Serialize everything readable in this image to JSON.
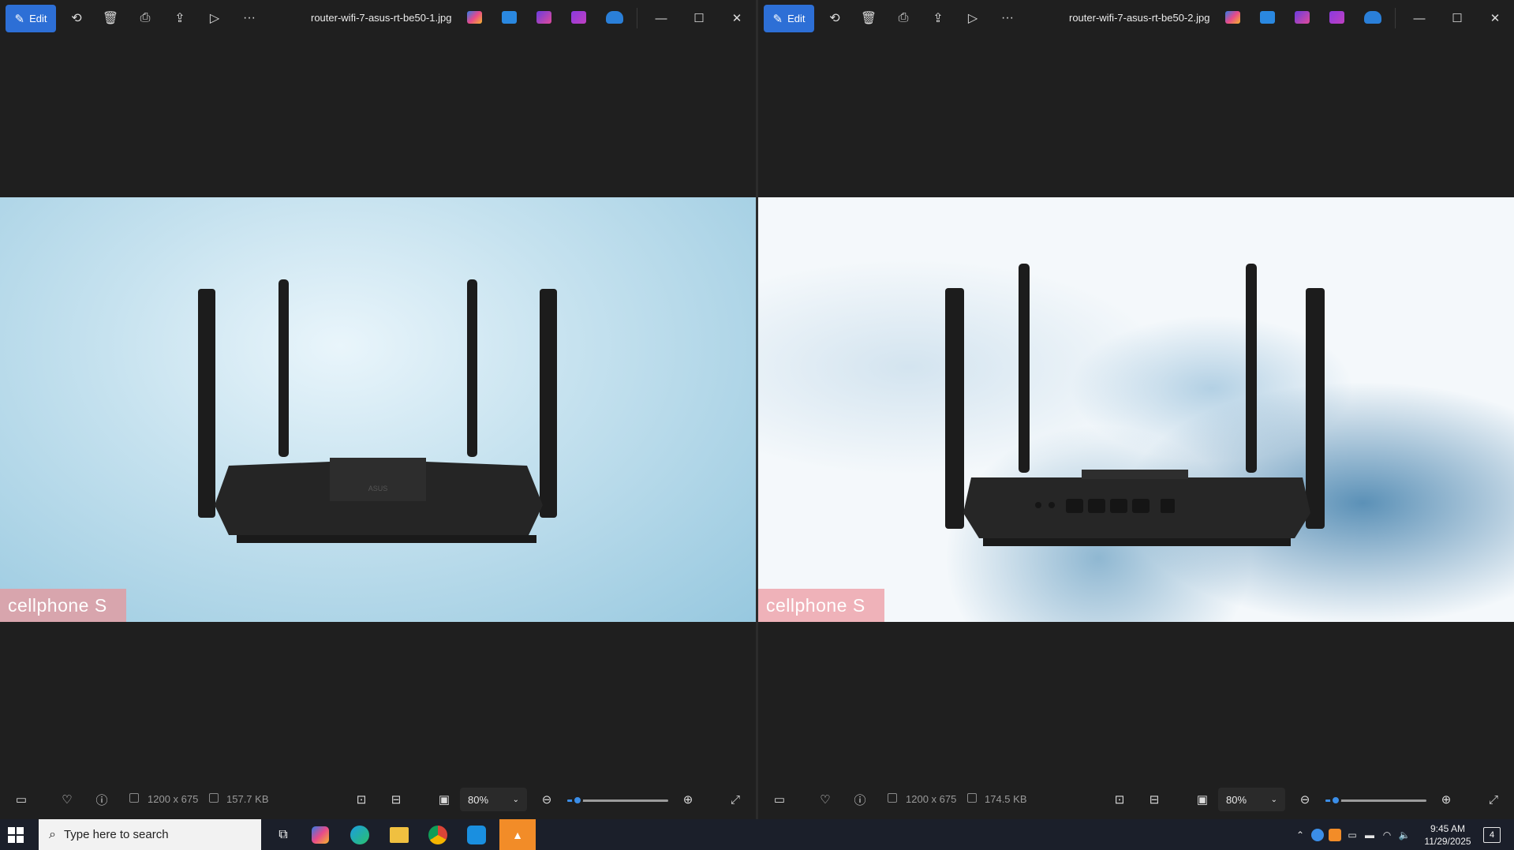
{
  "left_window": {
    "edit_label": "Edit",
    "filename": "router-wifi-7-asus-rt-be50-1.jpg",
    "dimensions": "1200 x 675",
    "filesize": "157.7 KB",
    "zoom": "80%",
    "zoom_slider_level": 0.1,
    "watermark": "cellphone S"
  },
  "right_window": {
    "edit_label": "Edit",
    "filename": "router-wifi-7-asus-rt-be50-2.jpg",
    "dimensions": "1200 x 675",
    "filesize": "174.5 KB",
    "zoom": "80%",
    "zoom_slider_level": 0.1,
    "watermark": "cellphone S"
  },
  "taskbar": {
    "search_placeholder": "Type here to search",
    "time": "9:45 AM",
    "date": "11/29/2025",
    "notification_count": "4"
  },
  "colors": {
    "accent": "#2d6fd6",
    "background": "#1f1f1f",
    "taskbar": "#1b1f2a"
  }
}
